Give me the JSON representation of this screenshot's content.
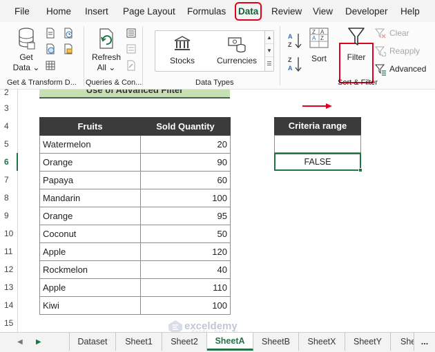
{
  "menu": {
    "items": [
      "File",
      "Home",
      "Insert",
      "Page Layout",
      "Formulas",
      "Data",
      "Review",
      "View",
      "Developer",
      "Help"
    ],
    "active": "Data"
  },
  "ribbon": {
    "get_data": "Get",
    "get_data2": "Data",
    "refresh": "Refresh",
    "refresh_all": "All",
    "stocks": "Stocks",
    "currencies": "Currencies",
    "sort": "Sort",
    "filter": "Filter",
    "clear": "Clear",
    "reapply": "Reapply",
    "advanced": "Advanced",
    "groups": {
      "get_transform": "Get & Transform D...",
      "queries": "Queries & Con...",
      "data_types": "Data Types",
      "sort_filter": "Sort & Filter"
    },
    "accent_color": "#e0001b"
  },
  "sheet": {
    "title": "Use of Advanced Filter",
    "row_numbers": [
      "2",
      "3",
      "4",
      "5",
      "6",
      "7",
      "8",
      "9",
      "10",
      "11",
      "12",
      "13",
      "14",
      "15"
    ],
    "headers": [
      "Fruits",
      "Sold Quantity"
    ],
    "rows": [
      [
        "Watermelon",
        "20"
      ],
      [
        "Orange",
        "90"
      ],
      [
        "Papaya",
        "60"
      ],
      [
        "Mandarin",
        "100"
      ],
      [
        "Orange",
        "95"
      ],
      [
        "Coconut",
        "50"
      ],
      [
        "Apple",
        "120"
      ],
      [
        "Rockmelon",
        "40"
      ],
      [
        "Apple",
        "110"
      ],
      [
        "Kiwi",
        "100"
      ]
    ],
    "criteria_header": "Criteria range",
    "criteria_value": "FALSE"
  },
  "tabs": {
    "items": [
      "Dataset",
      "Sheet1",
      "Sheet2",
      "SheetA",
      "SheetB",
      "SheetX",
      "SheetY",
      "She"
    ],
    "active": "SheetA",
    "more": "..."
  },
  "watermark": {
    "name": "exceldemy",
    "sub": "EXCEL · DATA · BI"
  }
}
